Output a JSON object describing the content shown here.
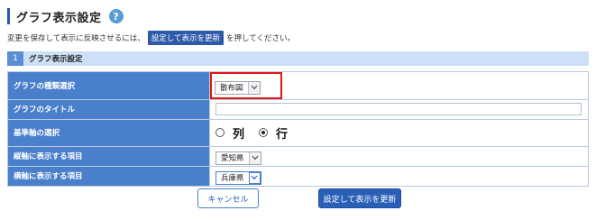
{
  "page": {
    "title": "グラフ表示設定",
    "help_icon": "?"
  },
  "note": {
    "prefix": "変更を保存して表示に反映させるには、",
    "chip": "設定して表示を更新",
    "suffix": "を押してください。"
  },
  "section": {
    "number": "1",
    "title": "グラフ表示設定"
  },
  "form": {
    "graph_type": {
      "label": "グラフの種類選択",
      "value": "散布図"
    },
    "graph_title": {
      "label": "グラフのタイトル",
      "value": ""
    },
    "axis_select": {
      "label": "基準軸の選択",
      "options": [
        {
          "label": "列",
          "checked": false
        },
        {
          "label": "行",
          "checked": true
        }
      ]
    },
    "vertical_axis": {
      "label": "縦軸に表示する項目",
      "value": "愛知県"
    },
    "horizontal_axis": {
      "label": "横軸に表示する項目",
      "value": "兵庫県"
    }
  },
  "buttons": {
    "cancel": "キャンセル",
    "update": "設定して表示を更新"
  },
  "icons": {
    "dropdown": "chevron-down-icon",
    "help": "question-circle-icon"
  },
  "colors": {
    "accent": "#2a5fb8",
    "label_bg": "#4a7fcc",
    "section_bg": "#cde0f7",
    "highlight": "#e01515"
  }
}
